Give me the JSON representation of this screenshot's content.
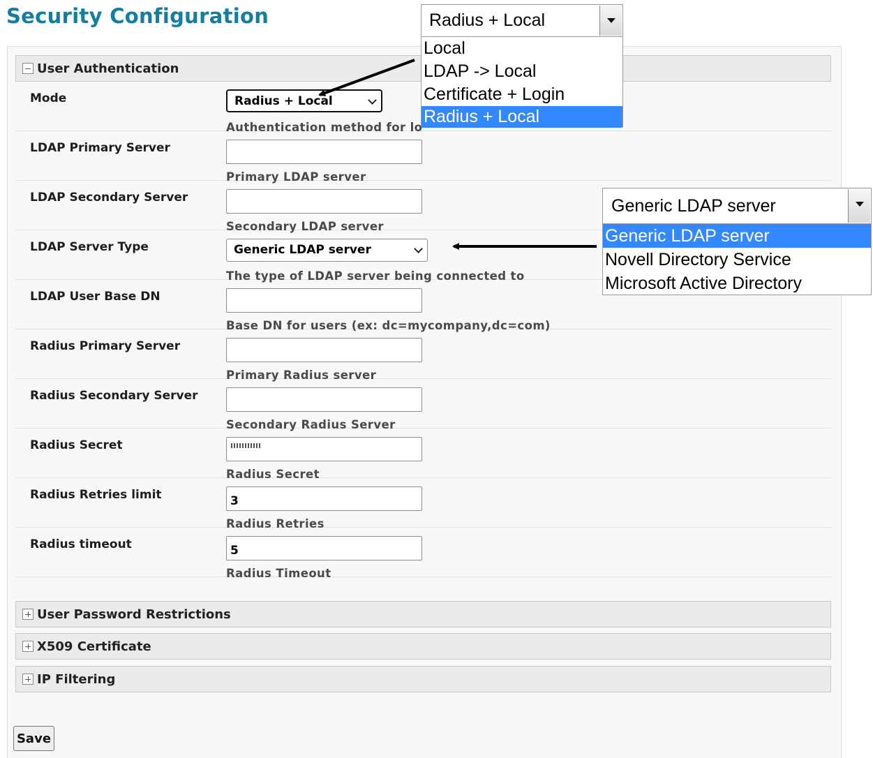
{
  "page": {
    "title": "Security Configuration"
  },
  "user_authentication": {
    "title": "User Authentication",
    "expanded": true,
    "rows": {
      "mode": {
        "label": "Mode",
        "value": "Radius + Local",
        "hint": "Authentication method for lo"
      },
      "ldap_primary": {
        "label": "LDAP Primary Server",
        "value": "",
        "hint": "Primary LDAP server"
      },
      "ldap_secondary": {
        "label": "LDAP Secondary Server",
        "value": "",
        "hint": "Secondary LDAP server"
      },
      "ldap_type": {
        "label": "LDAP Server Type",
        "value": "Generic LDAP server",
        "hint": "The type of LDAP server being connected to"
      },
      "ldap_base_dn": {
        "label": "LDAP User Base DN",
        "value": "",
        "hint": "Base DN for users (ex: dc=mycompany,dc=com)"
      },
      "radius_primary": {
        "label": "Radius Primary Server",
        "value": "",
        "hint": "Primary Radius server"
      },
      "radius_secondary": {
        "label": "Radius Secondary Server",
        "value": "",
        "hint": "Secondary Radius Server"
      },
      "radius_secret": {
        "label": "Radius Secret",
        "value": "",
        "hint": "Radius Secret"
      },
      "radius_retries": {
        "label": "Radius Retries limit",
        "value": "3",
        "hint": "Radius Retries"
      },
      "radius_timeout": {
        "label": "Radius timeout",
        "value": "5",
        "hint": "Radius Timeout"
      }
    }
  },
  "collapsed_sections": {
    "password": "User Password Restrictions",
    "x509": "X509 Certificate",
    "ip_filter": "IP Filtering"
  },
  "save_label": "Save",
  "mode_dropdown": {
    "selected": "Radius + Local",
    "options": [
      "Local",
      "LDAP -> Local",
      "Certificate + Login",
      "Radius + Local"
    ],
    "highlighted_index": 3
  },
  "ldap_type_dropdown": {
    "selected": "Generic LDAP server",
    "options": [
      "Generic LDAP server",
      "Novell Directory Service",
      "Microsoft Active Directory"
    ],
    "highlighted_index": 0
  },
  "colors": {
    "title": "#137ea0",
    "highlight": "#3388ff"
  }
}
